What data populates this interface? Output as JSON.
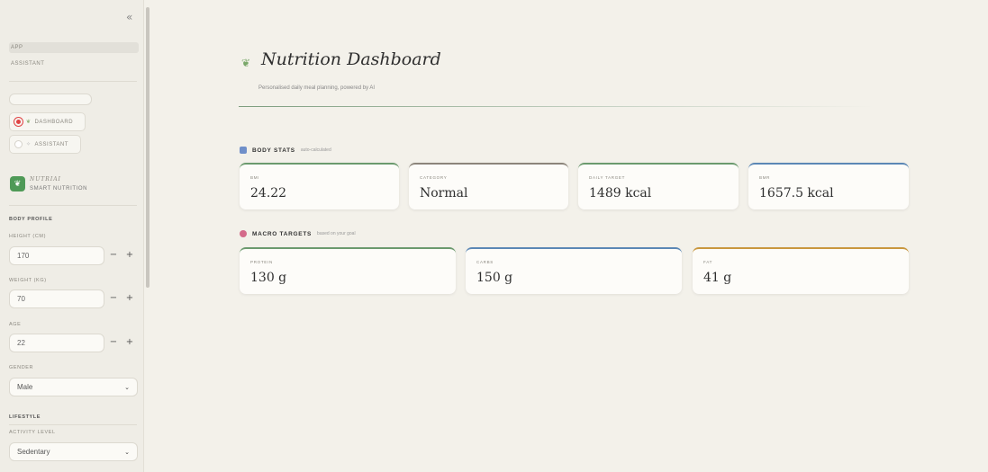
{
  "sidebar": {
    "collapse_glyph": "«",
    "nav": [
      {
        "label": "APP",
        "active": true
      },
      {
        "label": "ASSISTANT",
        "active": false
      }
    ],
    "pages": [
      {
        "label": "DASHBOARD",
        "icon": "sprout-icon",
        "selected": true
      },
      {
        "label": "ASSISTANT",
        "icon": "sparkle-icon",
        "selected": false
      }
    ],
    "brand": {
      "name": "NUTRIAI",
      "subtitle": "SMART NUTRITION",
      "logo_glyph": "❦",
      "logo_color": "#4f9a57"
    },
    "body_profile": {
      "section_label": "BODY PROFILE",
      "height": {
        "label": "HEIGHT (CM)",
        "value": "170"
      },
      "weight": {
        "label": "WEIGHT (KG)",
        "value": "70"
      },
      "age": {
        "label": "AGE",
        "value": "22"
      },
      "gender": {
        "label": "GENDER",
        "value": "Male"
      }
    },
    "lifestyle": {
      "section_label": "LIFESTYLE",
      "activity": {
        "label": "ACTIVITY LEVEL",
        "value": "Sedentary"
      }
    },
    "stepper": {
      "minus": "−",
      "plus": "+"
    },
    "chevron": "⌄"
  },
  "header": {
    "title": "Nutrition Dashboard",
    "subtitle": "Personalised daily meal planning, powered by AI",
    "icon_glyph": "❦"
  },
  "body_stats": {
    "title": "BODY STATS",
    "note": "auto-calculated",
    "cards": [
      {
        "label": "BMI",
        "value": "24.22",
        "accent": "#6b9a6e"
      },
      {
        "label": "CATEGORY",
        "value": "Normal",
        "accent": "#8c857b"
      },
      {
        "label": "DAILY TARGET",
        "value": "1489 kcal",
        "accent": "#6b9a6e"
      },
      {
        "label": "BMR",
        "value": "1657.5 kcal",
        "accent": "#5b87b5"
      }
    ]
  },
  "macro_targets": {
    "title": "MACRO TARGETS",
    "note": "based on your goal",
    "cards": [
      {
        "label": "PROTEIN",
        "value": "130 g",
        "accent": "#6b9a6e"
      },
      {
        "label": "CARBS",
        "value": "150 g",
        "accent": "#5b87b5"
      },
      {
        "label": "FAT",
        "value": "41 g",
        "accent": "#c9973e"
      }
    ]
  },
  "colors": {
    "background": "#f3f1ea",
    "sidebar": "#efede6",
    "radio_active": "#e04545"
  }
}
